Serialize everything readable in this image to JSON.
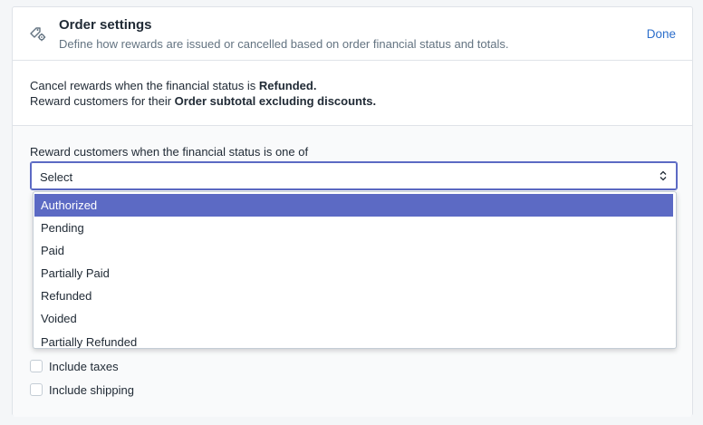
{
  "header": {
    "icon": "tag-gear-icon",
    "title": "Order settings",
    "subtitle": "Define how rewards are issued or cancelled based on order financial status and totals.",
    "done_label": "Done"
  },
  "summary": {
    "line1_prefix": "Cancel rewards when the financial status is ",
    "line1_value": "Refunded.",
    "line2_prefix": "Reward customers for their ",
    "line2_value": "Order subtotal excluding discounts."
  },
  "status_field": {
    "label": "Reward customers when the financial status is one of",
    "value": "Select",
    "options": [
      "Authorized",
      "Pending",
      "Paid",
      "Partially Paid",
      "Refunded",
      "Voided",
      "Partially Refunded"
    ],
    "highlighted_option": "Authorized"
  },
  "checkboxes": {
    "include_taxes": {
      "label": "Include taxes",
      "checked": false
    },
    "include_shipping": {
      "label": "Include shipping",
      "checked": false
    }
  },
  "colors": {
    "accent": "#5c6ac4",
    "link": "#2c6ecb",
    "border": "#dfe3e8",
    "muted_text": "#637381"
  }
}
